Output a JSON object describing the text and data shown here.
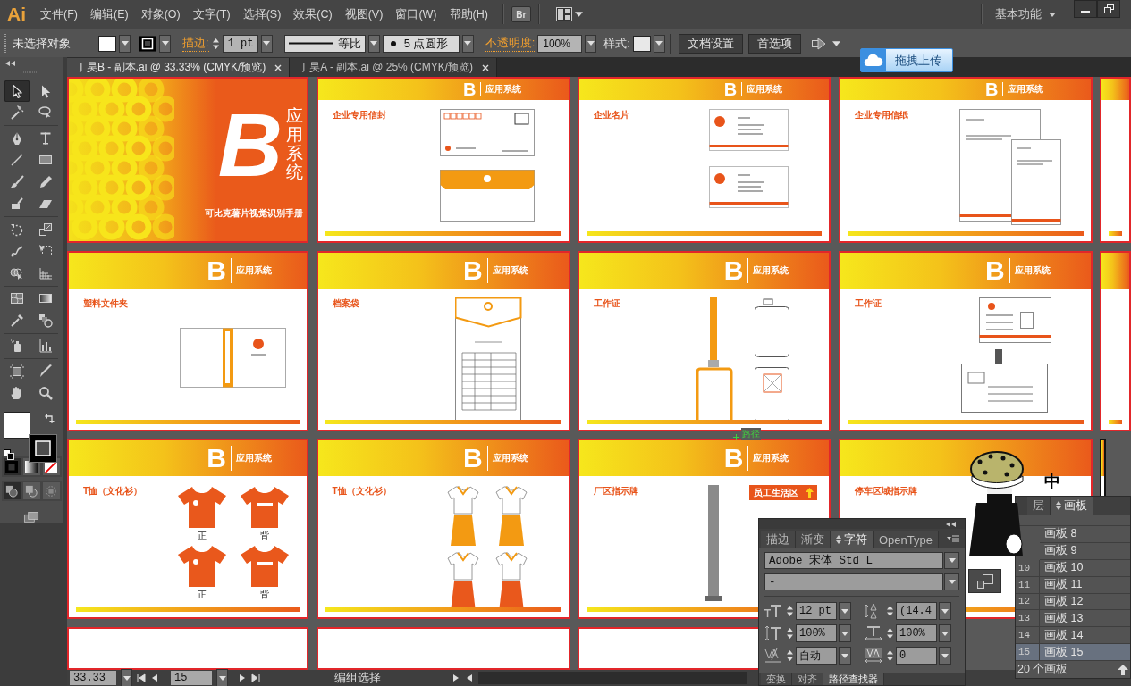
{
  "app": {
    "logo": "Ai"
  },
  "menus": [
    "文件(F)",
    "编辑(E)",
    "对象(O)",
    "文字(T)",
    "选择(S)",
    "效果(C)",
    "视图(V)",
    "窗口(W)",
    "帮助(H)"
  ],
  "bridge": "Br",
  "workspace": "基本功能",
  "control_bar": {
    "selection": "未选择对象",
    "stroke_label": "描边:",
    "stroke_weight": "1 pt",
    "stroke_profile": "等比",
    "brush": "5 点圆形",
    "opacity_label": "不透明度:",
    "opacity": "100%",
    "style_label": "样式:",
    "buttons": [
      "文档设置",
      "首选项"
    ]
  },
  "upload_button": "拖拽上传",
  "doc_tabs": [
    {
      "title": "丁昊B - 副本.ai @ 33.33% (CMYK/预览)",
      "selected": true
    },
    {
      "title": "丁昊A - 副本.ai @ 25% (CMYK/预览)",
      "selected": false
    }
  ],
  "tools": [
    {
      "selected": true
    },
    {
      "selected": false
    },
    {
      "selected": false
    },
    {
      "selected": false
    },
    {
      "selected": false
    },
    {
      "selected": false
    },
    {
      "selected": false
    },
    {
      "selected": false
    },
    {
      "selected": false
    },
    {
      "selected": false
    },
    {
      "selected": false
    },
    {
      "selected": false
    },
    {
      "selected": false
    },
    {
      "selected": false
    },
    {
      "selected": false
    },
    {
      "selected": false
    },
    {
      "selected": false
    },
    {
      "selected": false
    },
    {
      "selected": false
    },
    {
      "selected": false
    },
    {
      "selected": false
    },
    {
      "selected": false
    },
    {
      "selected": false
    },
    {
      "selected": false
    },
    {
      "selected": false
    },
    {
      "selected": false
    },
    {
      "selected": false
    },
    {
      "selected": false
    }
  ],
  "color_modes": [
    {
      "selected": true
    },
    {
      "selected": false
    },
    {
      "selected": false
    }
  ],
  "draw_modes": [
    {
      "selected": true
    },
    {
      "selected": false
    },
    {
      "selected": false
    }
  ],
  "artboards": [
    {
      "kind": "cover",
      "selected": false,
      "letter": "B",
      "heading": "应用系统",
      "subtitle": "可比克薯片视觉识别手册"
    },
    {
      "kind": "envelope",
      "selected": false,
      "letter": "B",
      "header": "应用系统",
      "title": "企业专用信封"
    },
    {
      "kind": "cards",
      "selected": false,
      "letter": "B",
      "header": "应用系统",
      "title": "企业名片"
    },
    {
      "kind": "letterhead",
      "selected": false,
      "letter": "B",
      "header": "应用系统",
      "title": "企业专用信纸"
    },
    {
      "kind": "partial",
      "selected": false
    },
    {
      "kind": "folder",
      "selected": false,
      "letter": "B",
      "header": "应用系统",
      "title": "塑料文件夹"
    },
    {
      "kind": "bag",
      "selected": false,
      "letter": "B",
      "header": "应用系统",
      "title": "档案袋"
    },
    {
      "kind": "lanyard",
      "selected": false,
      "letter": "B",
      "header": "应用系统",
      "title": "工作证"
    },
    {
      "kind": "badge",
      "selected": false,
      "letter": "B",
      "header": "应用系统",
      "title": "工作证"
    },
    {
      "kind": "partial",
      "selected": false
    },
    {
      "kind": "tshirts",
      "selected": false,
      "letter": "B",
      "header": "应用系统",
      "title": "T恤（文化衫）",
      "labels": [
        "正",
        "背",
        "正",
        "背"
      ]
    },
    {
      "kind": "uniforms",
      "selected": false,
      "letter": "B",
      "header": "应用系统",
      "title": "T恤（文化衫）"
    },
    {
      "kind": "signpost",
      "selected": false,
      "letter": "B",
      "header": "应用系统",
      "title": "厂区指示牌",
      "sign": "员工生活区"
    },
    {
      "kind": "parking",
      "selected": false,
      "title": "停车区域指示牌"
    },
    {
      "kind": "partial",
      "selected": true
    },
    {
      "kind": "blank",
      "selected": false
    },
    {
      "kind": "blank",
      "selected": false
    },
    {
      "kind": "blank",
      "selected": false
    }
  ],
  "smart_guide": "路径",
  "overlay_char": "中",
  "character_panel": {
    "tabs": [
      {
        "label": "描边",
        "selected": false
      },
      {
        "label": "渐变",
        "selected": false
      },
      {
        "label": "字符",
        "selected": true
      },
      {
        "label": "OpenType",
        "selected": false
      }
    ],
    "font_family": "Adobe 宋体 Std L",
    "font_style": "-",
    "font_size": "12 pt",
    "leading": "(14.4",
    "vertical_scale": "100%",
    "horizontal_scale": "100%",
    "kerning": "自动",
    "tracking": "0",
    "bottom_tabs": [
      {
        "label": "变换",
        "selected": false
      },
      {
        "label": "对齐",
        "selected": false
      },
      {
        "label": "路径查找器",
        "selected": true
      }
    ]
  },
  "artboards_panel": {
    "tabs": [
      {
        "label": "层",
        "selected": false
      },
      {
        "label": "画板",
        "selected": true
      }
    ],
    "rows": [
      {
        "name": "画板 8",
        "selected": false
      },
      {
        "name": "画板 9",
        "selected": false
      },
      {
        "number": "10",
        "name": "画板 10",
        "selected": false
      },
      {
        "number": "11",
        "name": "画板 11",
        "selected": false
      },
      {
        "number": "12",
        "name": "画板 12",
        "selected": false
      },
      {
        "number": "13",
        "name": "画板 13",
        "selected": false
      },
      {
        "number": "14",
        "name": "画板 14",
        "selected": false
      },
      {
        "number": "15",
        "name": "画板 15",
        "selected": true
      }
    ],
    "count": "20 个画板"
  },
  "status_bar": {
    "zoom": "33.33",
    "artboard": "15",
    "status": "编组选择"
  }
}
